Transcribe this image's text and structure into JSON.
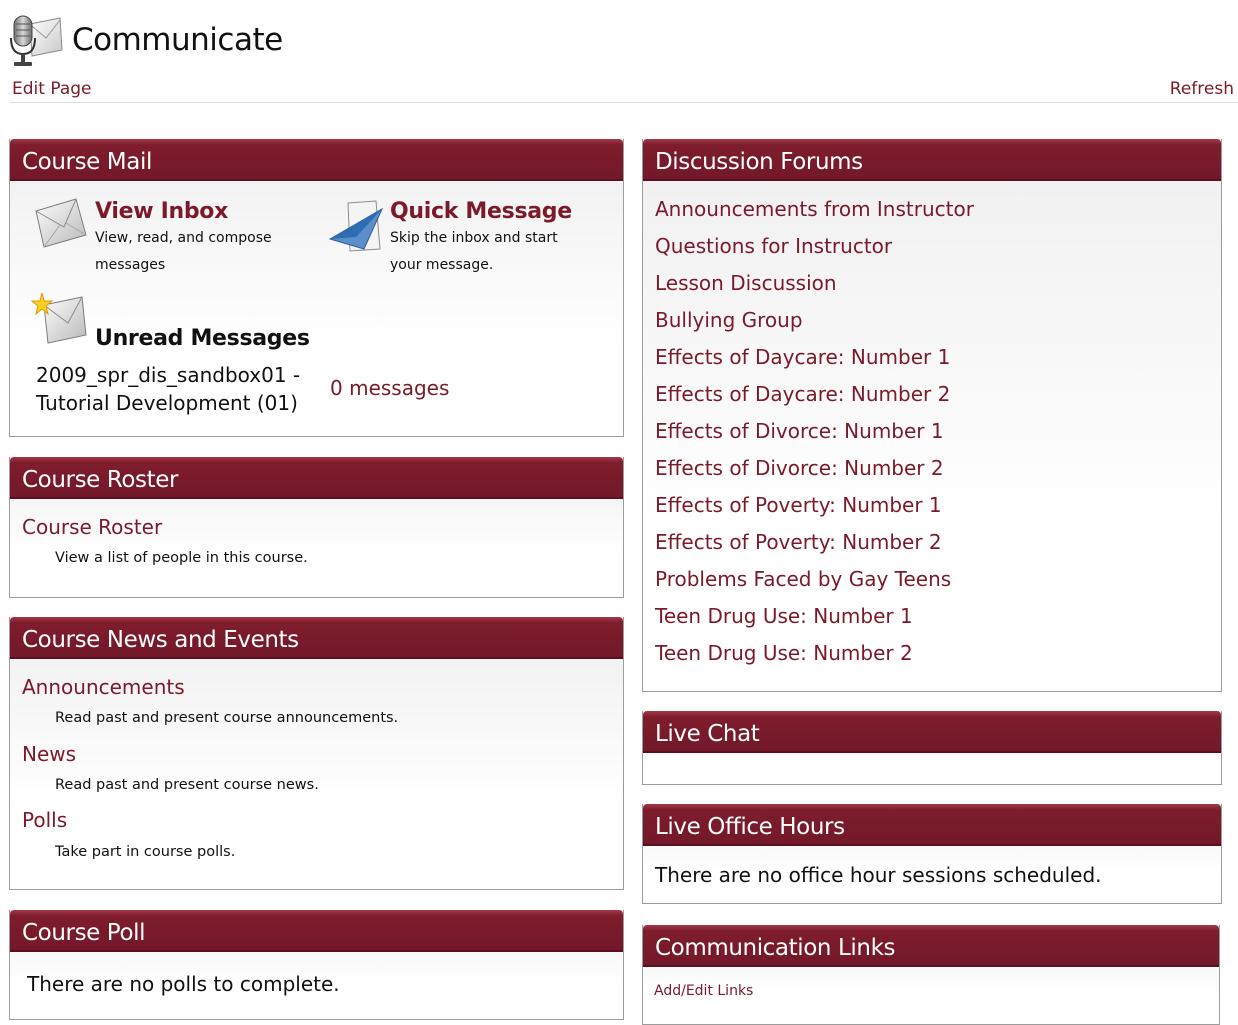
{
  "header": {
    "title": "Communicate",
    "edit_label": "Edit Page",
    "refresh_label": "Refresh",
    "icon": "microphone-icon"
  },
  "course_mail": {
    "title": "Course Mail",
    "view_inbox": {
      "label": "View Inbox",
      "desc1": "View, read, and compose",
      "desc2": "messages",
      "icon": "envelope-icon"
    },
    "quick_message": {
      "label": "Quick Message",
      "desc1": "Skip the inbox and start",
      "desc2": "your message.",
      "icon": "paper-plane-icon"
    },
    "unread": {
      "label": "Unread Messages",
      "icon": "new-mail-icon",
      "course_line1": "2009_spr_dis_sandbox01 -",
      "course_line2": "Tutorial Development (01)",
      "count": "0 messages"
    }
  },
  "course_roster": {
    "title": "Course Roster",
    "link": "Course Roster",
    "desc": "View a list of people in this course."
  },
  "course_news": {
    "title": "Course News and Events",
    "items": [
      {
        "label": "Announcements",
        "desc": "Read past and present course announcements."
      },
      {
        "label": "News",
        "desc": "Read past and present course news."
      },
      {
        "label": "Polls",
        "desc": "Take part in course polls."
      }
    ]
  },
  "course_poll": {
    "title": "Course Poll",
    "message": "There are no polls to complete."
  },
  "discussion_forums": {
    "title": "Discussion Forums",
    "items": [
      "Announcements from Instructor",
      "Questions for Instructor",
      "Lesson Discussion",
      "Bullying Group",
      "Effects of Daycare: Number 1",
      "Effects of Daycare: Number 2",
      "Effects of Divorce: Number 1",
      "Effects of Divorce: Number 2",
      "Effects of Poverty: Number 1",
      "Effects of Poverty: Number 2",
      "Problems Faced by Gay Teens",
      "Teen Drug Use: Number 1",
      "Teen Drug Use: Number 2"
    ]
  },
  "live_chat": {
    "title": "Live Chat"
  },
  "live_office_hours": {
    "title": "Live Office Hours",
    "message": "There are no office hour sessions scheduled."
  },
  "communication_links": {
    "title": "Communication Links",
    "link": "Add/Edit Links"
  },
  "colors": {
    "header_bar": "#7e1c2c",
    "link": "#7a1a2a"
  }
}
